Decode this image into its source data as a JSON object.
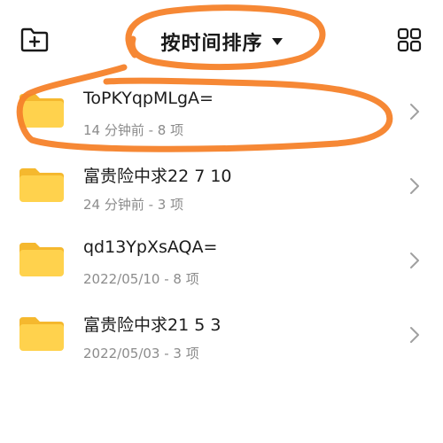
{
  "header": {
    "sort_label": "按时间排序",
    "new_folder_icon": "folder-plus-icon",
    "grid_view_icon": "grid-view-icon",
    "sort_caret_icon": "caret-down-icon"
  },
  "folders": [
    {
      "name": "ToPKYqpMLgA=",
      "meta": "14 分钟前 - 8 项"
    },
    {
      "name": "富贵险中求22 7 10",
      "meta": "24 分钟前 - 3 项"
    },
    {
      "name": "qd13YpXsAQA=",
      "meta": "2022/05/10 - 8 项"
    },
    {
      "name": "富贵险中求21 5 3",
      "meta": "2022/05/03 - 3 项"
    }
  ],
  "colors": {
    "folder_yellow": "#FFD24D",
    "folder_tab": "#F5B82E",
    "annotation_orange": "#F5822A",
    "meta_gray": "#8C8C8C"
  }
}
